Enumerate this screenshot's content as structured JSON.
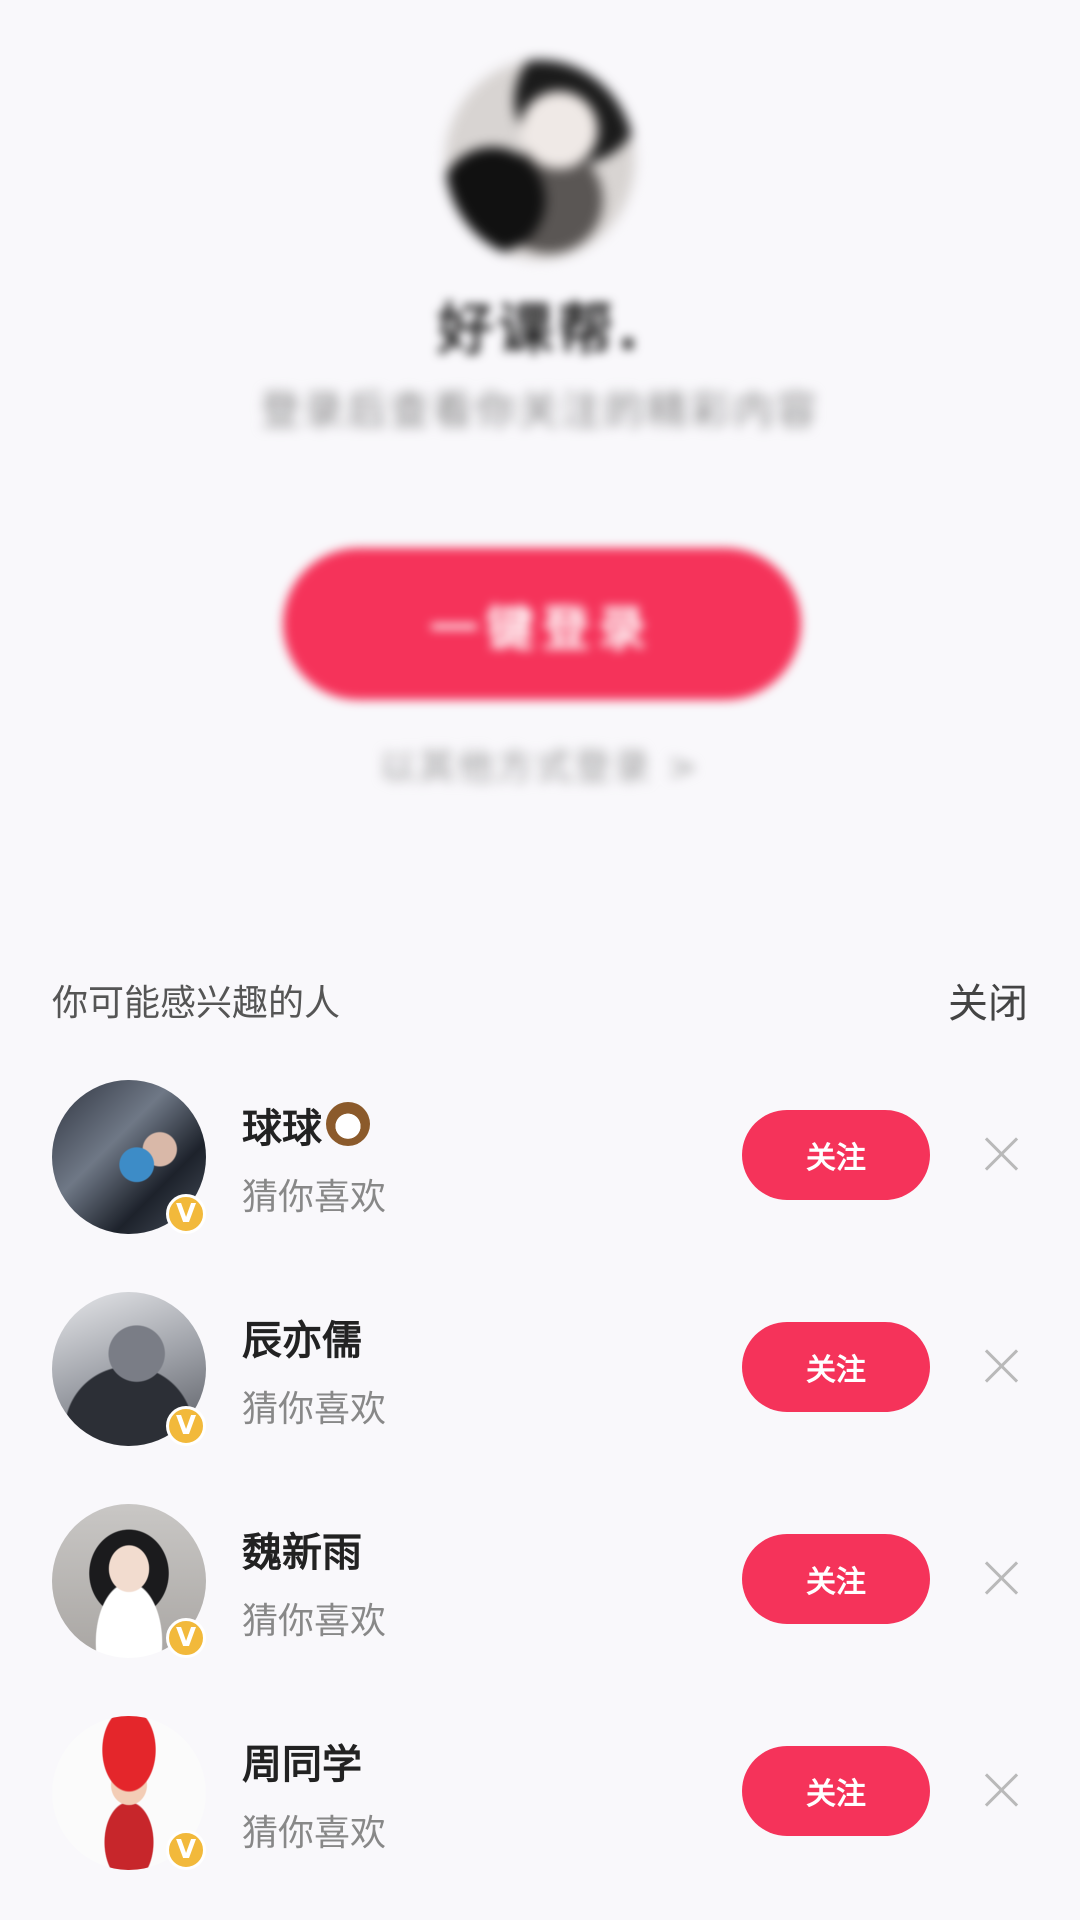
{
  "login": {
    "nickname": "好课帮.",
    "subtitle": "登录后查看你关注的精彩内容",
    "login_button": "一键登录",
    "other_login": "以其他方式登录 >"
  },
  "recommend": {
    "title": "你可能感兴趣的人",
    "close_label": "关闭",
    "users": [
      {
        "name": "球球",
        "emoji": "coconut-icon",
        "subtitle": "猜你喜欢",
        "follow_label": "关注",
        "badge": "V"
      },
      {
        "name": "辰亦儒",
        "subtitle": "猜你喜欢",
        "follow_label": "关注",
        "badge": "V"
      },
      {
        "name": "魏新雨",
        "subtitle": "猜你喜欢",
        "follow_label": "关注",
        "badge": "V"
      },
      {
        "name": "周同学",
        "subtitle": "猜你喜欢",
        "follow_label": "关注",
        "badge": "V"
      }
    ]
  },
  "colors": {
    "accent": "#f5335a",
    "badge": "#f2b93b",
    "background": "#f9f8fb"
  }
}
